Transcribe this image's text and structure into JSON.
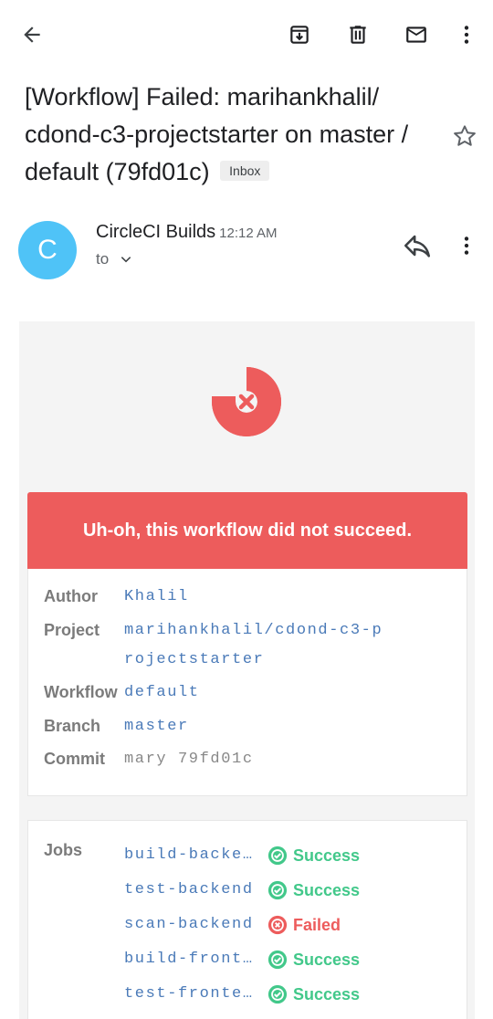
{
  "toolbar": {
    "back_icon": "arrow-left-icon",
    "archive_icon": "archive-icon",
    "delete_icon": "trash-icon",
    "mark_unread_icon": "mail-icon",
    "more_icon": "more-vert-icon"
  },
  "email": {
    "subject": "[Workflow] Failed: marihankhalil/ cdond-c3-projectstarter on master / default (79fd01c)",
    "label_badge": "Inbox",
    "starred": false,
    "sender": {
      "avatar_letter": "C",
      "avatar_color": "#4fc3f7",
      "name": "CircleCI Builds",
      "time": "12:12 AM",
      "to_label": "to"
    }
  },
  "body": {
    "banner_text": "Uh-oh, this workflow did not succeed.",
    "banner_color": "#ed5c5c",
    "details": [
      {
        "label": "Author",
        "value": "Khalil"
      },
      {
        "label": "Project",
        "value": "marihankhalil/cdond-c3-projectstarter"
      },
      {
        "label": "Workflow",
        "value": "default"
      },
      {
        "label": "Branch",
        "value": "master"
      },
      {
        "label": "Commit",
        "value": "mary 79fd01c"
      }
    ],
    "jobs_label": "Jobs",
    "jobs": [
      {
        "name": "build-backe…",
        "status": "Success"
      },
      {
        "name": "test-backend",
        "status": "Success"
      },
      {
        "name": "scan-backend",
        "status": "Failed"
      },
      {
        "name": "build-front…",
        "status": "Success"
      },
      {
        "name": "test-fronte…",
        "status": "Success"
      }
    ]
  }
}
